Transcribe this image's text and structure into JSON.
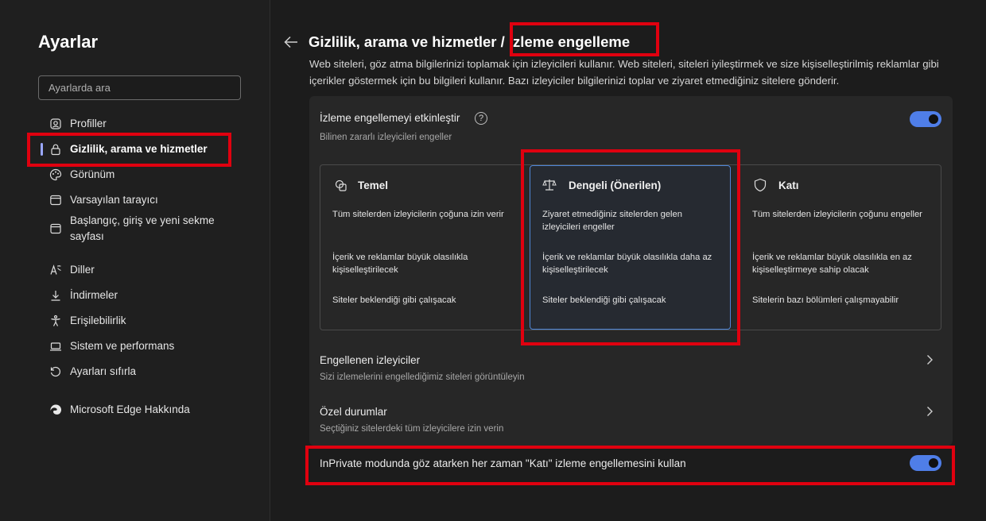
{
  "sidebar": {
    "title": "Ayarlar",
    "search_placeholder": "Ayarlarda ara",
    "items": [
      {
        "label": "Profiller",
        "icon": "profile-icon"
      },
      {
        "label": "Gizlilik, arama ve hizmetler",
        "icon": "lock-icon",
        "active": true
      },
      {
        "label": "Görünüm",
        "icon": "palette-icon"
      },
      {
        "label": "Varsayılan tarayıcı",
        "icon": "browser-icon"
      },
      {
        "label": "Başlangıç, giriş ve yeni sekme sayfası",
        "icon": "home-icon"
      },
      {
        "label": "Diller",
        "icon": "language-icon"
      },
      {
        "label": "İndirmeler",
        "icon": "download-icon"
      },
      {
        "label": "Erişilebilirlik",
        "icon": "accessibility-icon"
      },
      {
        "label": "Sistem ve performans",
        "icon": "laptop-icon"
      },
      {
        "label": "Ayarları sıfırla",
        "icon": "reset-icon"
      },
      {
        "label": "Microsoft Edge Hakkında",
        "icon": "edge-logo-icon"
      }
    ]
  },
  "header": {
    "breadcrumb_parent": "Gizlilik, arama ve hizmetler",
    "separator": "/",
    "breadcrumb_current": "İzleme engelleme",
    "description": "Web siteleri, göz atma bilgilerinizi toplamak için izleyicileri kullanır. Web siteleri, siteleri iyileştirmek ve size kişiselleştirilmiş reklamlar gibi içerikler göstermek için bu bilgileri kullanır. Bazı izleyiciler bilgilerinizi toplar ve ziyaret etmediğiniz sitelere gönderir."
  },
  "tracking": {
    "enable_label": "İzleme engellemeyi etkinleştir",
    "enable_sub": "Bilinen zararlı izleyicileri engeller",
    "enabled": true,
    "options": [
      {
        "title": "Temel",
        "icon": "basic-shapes-icon",
        "lines": [
          "Tüm sitelerden izleyicilerin çoğuna izin verir",
          "İçerik ve reklamlar büyük olasılıkla kişiselleştirilecek",
          "Siteler beklendiği gibi çalışacak"
        ]
      },
      {
        "title": "Dengeli (Önerilen)",
        "icon": "balance-scale-icon",
        "selected": true,
        "lines": [
          "Ziyaret etmediğiniz sitelerden gelen izleyicileri engeller",
          "İçerik ve reklamlar büyük olasılıkla daha az kişiselleştirilecek",
          "Siteler beklendiği gibi çalışacak"
        ]
      },
      {
        "title": "Katı",
        "icon": "shield-icon",
        "lines": [
          "Tüm sitelerden izleyicilerin çoğunu engeller",
          "İçerik ve reklamlar büyük olasılıkla en az kişiselleştirmeye sahip olacak",
          "Sitelerin bazı bölümleri çalışmayabilir"
        ]
      }
    ],
    "blocked_title": "Engellenen izleyiciler",
    "blocked_sub": "Sizi izlemelerini engellediğimiz siteleri görüntüleyin",
    "exceptions_title": "Özel durumlar",
    "exceptions_sub": "Seçtiğiniz sitelerdeki tüm izleyicilere izin verin",
    "inprivate_label": "InPrivate modunda göz atarken her zaman \"Katı\" izleme engellemesini kullan",
    "inprivate_enabled": true
  },
  "colors": {
    "accent": "#4f7ee8",
    "highlight": "#e0000f",
    "background": "#1c1c1c"
  }
}
